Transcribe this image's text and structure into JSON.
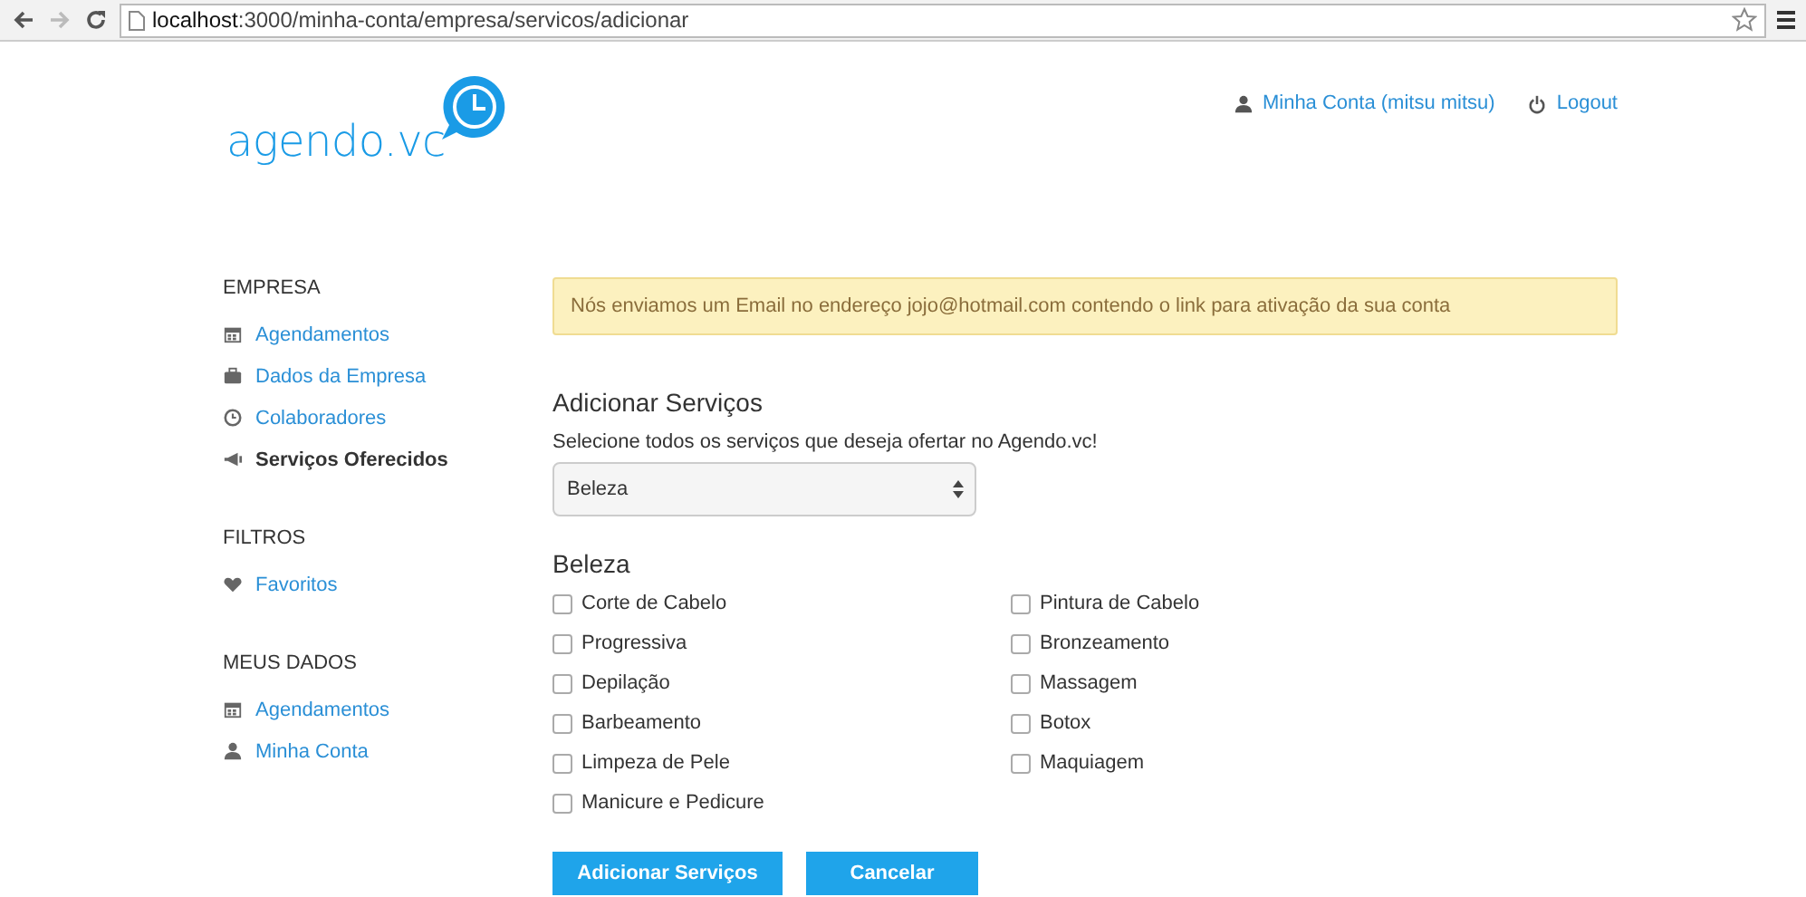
{
  "browser": {
    "url_host": "localhost",
    "url_path": ":3000/minha-conta/empresa/servicos/adicionar"
  },
  "header": {
    "logo": "agendo.vc",
    "account_link": "Minha Conta (mitsu mitsu)",
    "logout_link": "Logout"
  },
  "sidebar": {
    "sections": [
      {
        "title": "EMPRESA",
        "items": [
          {
            "label": "Agendamentos",
            "kind": "calendar",
            "selected": false
          },
          {
            "label": "Dados da Empresa",
            "kind": "briefcase",
            "selected": false
          },
          {
            "label": "Colaboradores",
            "kind": "clock",
            "selected": false
          },
          {
            "label": "Serviços Oferecidos",
            "kind": "megaphone",
            "selected": true
          }
        ]
      },
      {
        "title": "FILTROS",
        "items": [
          {
            "label": "Favoritos",
            "kind": "heart",
            "selected": false
          }
        ]
      },
      {
        "title": "MEUS DADOS",
        "items": [
          {
            "label": "Agendamentos",
            "kind": "calendar",
            "selected": false
          },
          {
            "label": "Minha Conta",
            "kind": "user",
            "selected": false
          }
        ]
      }
    ]
  },
  "alert": "Nós enviamos um Email no endereço jojo@hotmail.com contendo o link para ativação da sua conta",
  "form": {
    "title": "Adicionar Serviços",
    "subtitle": "Selecione todos os serviços que deseja ofertar no Agendo.vc!",
    "category_select": "Beleza",
    "group_title": "Beleza",
    "columns": [
      [
        {
          "label": "Corte de Cabelo",
          "checked": false
        },
        {
          "label": "Progressiva",
          "checked": false
        },
        {
          "label": "Depilação",
          "checked": false
        },
        {
          "label": "Barbeamento",
          "checked": false
        },
        {
          "label": "Limpeza de Pele",
          "checked": false
        },
        {
          "label": "Manicure e Pedicure",
          "checked": false
        }
      ],
      [
        {
          "label": "Pintura de Cabelo",
          "checked": false
        },
        {
          "label": "Bronzeamento",
          "checked": false
        },
        {
          "label": "Massagem",
          "checked": false
        },
        {
          "label": "Botox",
          "checked": false
        },
        {
          "label": "Maquiagem",
          "checked": false
        }
      ]
    ],
    "buttons": [
      "Adicionar Serviços",
      "Cancelar"
    ]
  }
}
